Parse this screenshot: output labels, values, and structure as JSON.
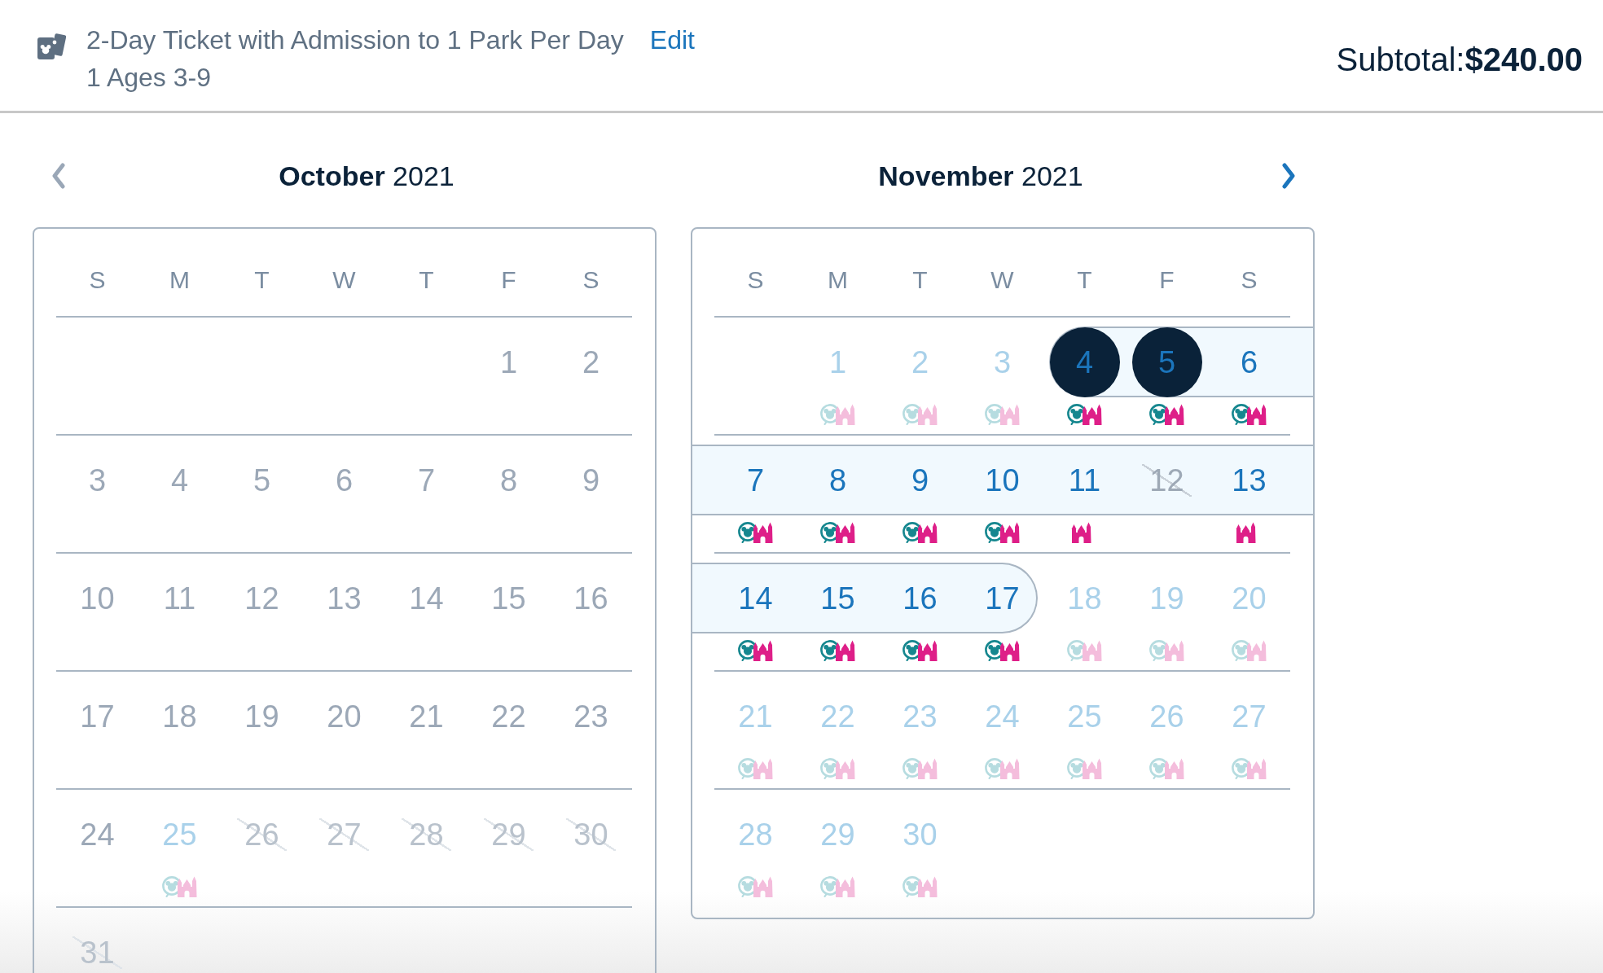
{
  "ticket": {
    "title": "2-Day Ticket with Admission to 1 Park Per Day",
    "edit_link": "Edit",
    "guests": "1 Ages 3-9"
  },
  "subtotal": {
    "label": "Subtotal:",
    "amount": "$240.00"
  },
  "months": [
    {
      "title": "**October** 2021",
      "nav": {
        "kind": "prev",
        "disabled": true
      },
      "weekdays": [
        "S",
        "M",
        "T",
        "W",
        "T",
        "F",
        "S"
      ],
      "weeks": [
        {
          "days": [
            {
              "kind": "blank"
            },
            {
              "kind": "blank"
            },
            {
              "kind": "blank"
            },
            {
              "kind": "blank"
            },
            {
              "kind": "blank"
            },
            {
              "day": "1",
              "kind": "past",
              "selected": false,
              "in_range": false
            },
            {
              "day": "2",
              "kind": "past",
              "selected": false,
              "in_range": false
            }
          ]
        },
        {
          "days": [
            {
              "day": "3",
              "kind": "past",
              "selected": false,
              "in_range": false
            },
            {
              "day": "4",
              "kind": "past",
              "selected": false,
              "in_range": false
            },
            {
              "day": "5",
              "kind": "past",
              "selected": false,
              "in_range": false
            },
            {
              "day": "6",
              "kind": "past",
              "selected": false,
              "in_range": false
            },
            {
              "day": "7",
              "kind": "past",
              "selected": false,
              "in_range": false
            },
            {
              "day": "8",
              "kind": "past",
              "selected": false,
              "in_range": false
            },
            {
              "day": "9",
              "kind": "past",
              "selected": false,
              "in_range": false
            }
          ]
        },
        {
          "days": [
            {
              "day": "10",
              "kind": "past",
              "selected": false,
              "in_range": false
            },
            {
              "day": "11",
              "kind": "past",
              "selected": false,
              "in_range": false
            },
            {
              "day": "12",
              "kind": "past",
              "selected": false,
              "in_range": false
            },
            {
              "day": "13",
              "kind": "past",
              "selected": false,
              "in_range": false
            },
            {
              "day": "14",
              "kind": "past",
              "selected": false,
              "in_range": false
            },
            {
              "day": "15",
              "kind": "past",
              "selected": false,
              "in_range": false
            },
            {
              "day": "16",
              "kind": "past",
              "selected": false,
              "in_range": false
            }
          ]
        },
        {
          "days": [
            {
              "day": "17",
              "kind": "past",
              "selected": false,
              "in_range": false
            },
            {
              "day": "18",
              "kind": "past",
              "selected": false,
              "in_range": false
            },
            {
              "day": "19",
              "kind": "past",
              "selected": false,
              "in_range": false
            },
            {
              "day": "20",
              "kind": "past",
              "selected": false,
              "in_range": false
            },
            {
              "day": "21",
              "kind": "past",
              "selected": false,
              "in_range": false
            },
            {
              "day": "22",
              "kind": "past",
              "selected": false,
              "in_range": false
            },
            {
              "day": "23",
              "kind": "past",
              "selected": false,
              "in_range": false
            }
          ]
        },
        {
          "days": [
            {
              "day": "24",
              "kind": "past",
              "selected": false,
              "in_range": false
            },
            {
              "day": "25",
              "kind": "available",
              "selected": false,
              "in_range": false,
              "park_icons": [
                {
                  "kind": "wheel"
                },
                {
                  "kind": "castle"
                }
              ]
            },
            {
              "day": "26",
              "kind": "unavailable",
              "selected": false,
              "in_range": false
            },
            {
              "day": "27",
              "kind": "unavailable",
              "selected": false,
              "in_range": false
            },
            {
              "day": "28",
              "kind": "unavailable",
              "selected": false,
              "in_range": false
            },
            {
              "day": "29",
              "kind": "unavailable",
              "selected": false,
              "in_range": false
            },
            {
              "day": "30",
              "kind": "unavailable",
              "selected": false,
              "in_range": false
            }
          ]
        },
        {
          "days": [
            {
              "day": "31",
              "kind": "unavailable",
              "selected": false,
              "in_range": false
            }
          ]
        }
      ]
    },
    {
      "title": "**November** 2021",
      "nav": {
        "kind": "next",
        "disabled": false
      },
      "weekdays": [
        "S",
        "M",
        "T",
        "W",
        "T",
        "F",
        "S"
      ],
      "weeks": [
        {
          "days": [
            {
              "kind": "blank"
            },
            {
              "day": "1",
              "kind": "available",
              "selected": false,
              "in_range": false,
              "park_icons": [
                {
                  "kind": "wheel"
                },
                {
                  "kind": "castle"
                }
              ]
            },
            {
              "day": "2",
              "kind": "available",
              "selected": false,
              "in_range": false,
              "park_icons": [
                {
                  "kind": "wheel"
                },
                {
                  "kind": "castle"
                }
              ]
            },
            {
              "day": "3",
              "kind": "available",
              "selected": false,
              "in_range": false,
              "park_icons": [
                {
                  "kind": "wheel"
                },
                {
                  "kind": "castle"
                }
              ]
            },
            {
              "day": "4",
              "kind": "available",
              "selected": true,
              "in_range": true,
              "park_icons": [
                {
                  "kind": "wheel"
                },
                {
                  "kind": "castle"
                }
              ]
            },
            {
              "day": "5",
              "kind": "available",
              "selected": true,
              "in_range": true,
              "park_icons": [
                {
                  "kind": "wheel"
                },
                {
                  "kind": "castle"
                }
              ]
            },
            {
              "day": "6",
              "kind": "available",
              "selected": false,
              "in_range": true,
              "park_icons": [
                {
                  "kind": "wheel"
                },
                {
                  "kind": "castle"
                }
              ]
            }
          ]
        },
        {
          "days": [
            {
              "day": "7",
              "kind": "available",
              "selected": false,
              "in_range": true,
              "park_icons": [
                {
                  "kind": "wheel"
                },
                {
                  "kind": "castle"
                }
              ]
            },
            {
              "day": "8",
              "kind": "available",
              "selected": false,
              "in_range": true,
              "park_icons": [
                {
                  "kind": "wheel"
                },
                {
                  "kind": "castle"
                }
              ]
            },
            {
              "day": "9",
              "kind": "available",
              "selected": false,
              "in_range": true,
              "park_icons": [
                {
                  "kind": "wheel"
                },
                {
                  "kind": "castle"
                }
              ]
            },
            {
              "day": "10",
              "kind": "available",
              "selected": false,
              "in_range": true,
              "park_icons": [
                {
                  "kind": "wheel"
                },
                {
                  "kind": "castle"
                }
              ]
            },
            {
              "day": "11",
              "kind": "available",
              "selected": false,
              "in_range": true,
              "park_icons": [
                {
                  "kind": "castle"
                }
              ]
            },
            {
              "day": "12",
              "kind": "unavailable",
              "selected": false,
              "in_range": true
            },
            {
              "day": "13",
              "kind": "available",
              "selected": false,
              "in_range": true,
              "park_icons": [
                {
                  "kind": "castle"
                }
              ]
            }
          ]
        },
        {
          "days": [
            {
              "day": "14",
              "kind": "available",
              "selected": false,
              "in_range": true,
              "park_icons": [
                {
                  "kind": "wheel"
                },
                {
                  "kind": "castle"
                }
              ]
            },
            {
              "day": "15",
              "kind": "available",
              "selected": false,
              "in_range": true,
              "park_icons": [
                {
                  "kind": "wheel"
                },
                {
                  "kind": "castle"
                }
              ]
            },
            {
              "day": "16",
              "kind": "available",
              "selected": false,
              "in_range": true,
              "park_icons": [
                {
                  "kind": "wheel"
                },
                {
                  "kind": "castle"
                }
              ]
            },
            {
              "day": "17",
              "kind": "available",
              "selected": false,
              "in_range": true,
              "park_icons": [
                {
                  "kind": "wheel"
                },
                {
                  "kind": "castle"
                }
              ]
            },
            {
              "day": "18",
              "kind": "available",
              "selected": false,
              "in_range": false,
              "park_icons": [
                {
                  "kind": "wheel"
                },
                {
                  "kind": "castle"
                }
              ]
            },
            {
              "day": "19",
              "kind": "available",
              "selected": false,
              "in_range": false,
              "park_icons": [
                {
                  "kind": "wheel"
                },
                {
                  "kind": "castle"
                }
              ]
            },
            {
              "day": "20",
              "kind": "available",
              "selected": false,
              "in_range": false,
              "park_icons": [
                {
                  "kind": "wheel"
                },
                {
                  "kind": "castle"
                }
              ]
            }
          ]
        },
        {
          "days": [
            {
              "day": "21",
              "kind": "available",
              "selected": false,
              "in_range": false,
              "park_icons": [
                {
                  "kind": "wheel"
                },
                {
                  "kind": "castle"
                }
              ]
            },
            {
              "day": "22",
              "kind": "available",
              "selected": false,
              "in_range": false,
              "park_icons": [
                {
                  "kind": "wheel"
                },
                {
                  "kind": "castle"
                }
              ]
            },
            {
              "day": "23",
              "kind": "available",
              "selected": false,
              "in_range": false,
              "park_icons": [
                {
                  "kind": "wheel"
                },
                {
                  "kind": "castle"
                }
              ]
            },
            {
              "day": "24",
              "kind": "available",
              "selected": false,
              "in_range": false,
              "park_icons": [
                {
                  "kind": "wheel"
                },
                {
                  "kind": "castle"
                }
              ]
            },
            {
              "day": "25",
              "kind": "available",
              "selected": false,
              "in_range": false,
              "park_icons": [
                {
                  "kind": "wheel"
                },
                {
                  "kind": "castle"
                }
              ]
            },
            {
              "day": "26",
              "kind": "available",
              "selected": false,
              "in_range": false,
              "park_icons": [
                {
                  "kind": "wheel"
                },
                {
                  "kind": "castle"
                }
              ]
            },
            {
              "day": "27",
              "kind": "available",
              "selected": false,
              "in_range": false,
              "park_icons": [
                {
                  "kind": "wheel"
                },
                {
                  "kind": "castle"
                }
              ]
            }
          ]
        },
        {
          "days": [
            {
              "day": "28",
              "kind": "available",
              "selected": false,
              "in_range": false,
              "park_icons": [
                {
                  "kind": "wheel"
                },
                {
                  "kind": "castle"
                }
              ]
            },
            {
              "day": "29",
              "kind": "available",
              "selected": false,
              "in_range": false,
              "park_icons": [
                {
                  "kind": "wheel"
                },
                {
                  "kind": "castle"
                }
              ]
            },
            {
              "day": "30",
              "kind": "available",
              "selected": false,
              "in_range": false,
              "park_icons": [
                {
                  "kind": "wheel"
                },
                {
                  "kind": "castle"
                }
              ]
            }
          ]
        }
      ]
    }
  ]
}
